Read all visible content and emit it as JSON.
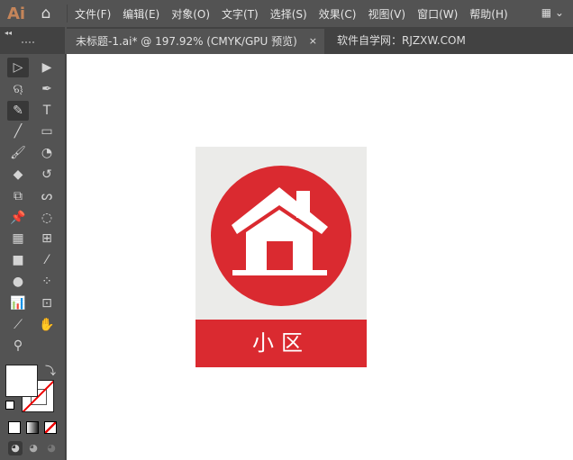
{
  "app": {
    "logo": "Ai"
  },
  "menu": [
    "文件(F)",
    "编辑(E)",
    "对象(O)",
    "文字(T)",
    "选择(S)",
    "效果(C)",
    "视图(V)",
    "窗口(W)",
    "帮助(H)"
  ],
  "tab": {
    "title": "未标题-1.ai* @ 197.92% (CMYK/GPU 预览)",
    "close": "×"
  },
  "watermark": "软件自学网：RJZXW.COM",
  "artwork": {
    "label": "小区",
    "colors": {
      "red": "#da2a30",
      "bg": "#ebebe9"
    }
  },
  "tools": [
    {
      "name": "selection-tool",
      "glyph": "▷",
      "active": true
    },
    {
      "name": "direct-selection-tool",
      "glyph": "▶"
    },
    {
      "name": "lasso-tool",
      "glyph": "ୠ"
    },
    {
      "name": "pen-tool",
      "glyph": "✒"
    },
    {
      "name": "curvature-tool",
      "glyph": "✎",
      "active": true
    },
    {
      "name": "type-tool",
      "glyph": "T"
    },
    {
      "name": "line-tool",
      "glyph": "╱"
    },
    {
      "name": "rectangle-tool",
      "glyph": "▭"
    },
    {
      "name": "paintbrush-tool",
      "glyph": "🖌"
    },
    {
      "name": "shaper-tool",
      "glyph": "◔"
    },
    {
      "name": "eraser-tool",
      "glyph": "◆"
    },
    {
      "name": "rotate-tool",
      "glyph": "↺"
    },
    {
      "name": "scale-tool",
      "glyph": "⧉"
    },
    {
      "name": "warp-tool",
      "glyph": "ᔕ"
    },
    {
      "name": "puppet-warp-tool",
      "glyph": "📌"
    },
    {
      "name": "free-transform-tool",
      "glyph": "◌"
    },
    {
      "name": "perspective-grid-tool",
      "glyph": "▦"
    },
    {
      "name": "mesh-tool",
      "glyph": "⊞"
    },
    {
      "name": "gradient-tool",
      "glyph": "■"
    },
    {
      "name": "eyedropper-tool",
      "glyph": "⁄"
    },
    {
      "name": "blend-tool",
      "glyph": "●"
    },
    {
      "name": "symbol-sprayer-tool",
      "glyph": "⁘"
    },
    {
      "name": "graph-tool",
      "glyph": "📊"
    },
    {
      "name": "artboard-tool",
      "glyph": "⊡"
    },
    {
      "name": "slice-tool",
      "glyph": "⟋"
    },
    {
      "name": "hand-tool",
      "glyph": "✋"
    },
    {
      "name": "zoom-tool",
      "glyph": "⚲"
    }
  ]
}
